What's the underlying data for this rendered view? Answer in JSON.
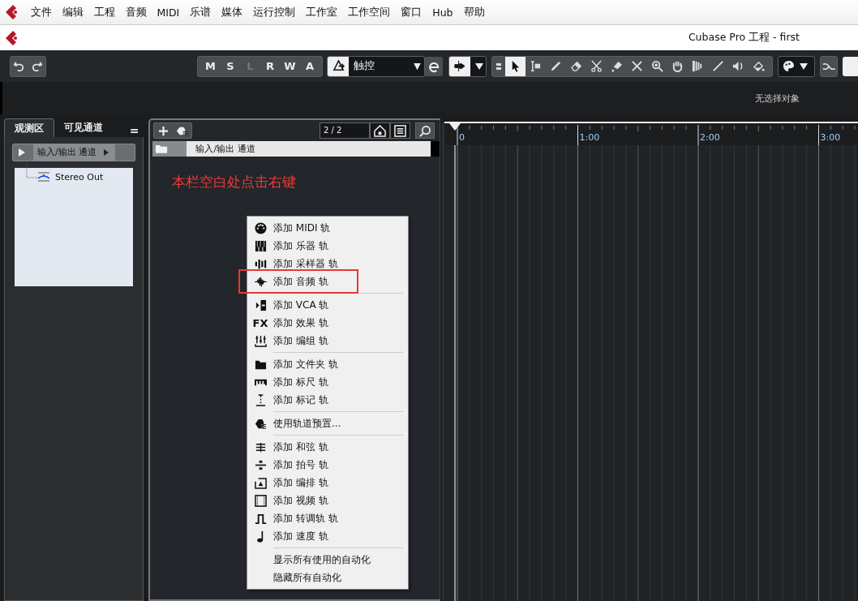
{
  "menu_bar": {
    "items": [
      "文件",
      "编辑",
      "工程",
      "音频",
      "MIDI",
      "乐谱",
      "媒体",
      "运行控制",
      "工作室",
      "工作空间",
      "窗口",
      "Hub",
      "帮助"
    ]
  },
  "window": {
    "title": "Cubase Pro 工程 - first"
  },
  "toolbar": {
    "mode_buttons": [
      {
        "label": "M",
        "disabled": false
      },
      {
        "label": "S",
        "disabled": false
      },
      {
        "label": "L",
        "disabled": true
      },
      {
        "label": "R",
        "disabled": false
      },
      {
        "label": "W",
        "disabled": false
      },
      {
        "label": "A",
        "disabled": false
      }
    ],
    "automation_mode": {
      "value": "触控",
      "arrow": "▼"
    },
    "tools": [
      {
        "kind": "pointer",
        "selected": true
      },
      {
        "kind": "range",
        "selected": false
      },
      {
        "kind": "pencil",
        "selected": false
      },
      {
        "kind": "eraser",
        "selected": false
      },
      {
        "kind": "scissors",
        "selected": false
      },
      {
        "kind": "glue",
        "selected": false
      },
      {
        "kind": "mute",
        "selected": false
      },
      {
        "kind": "zoom",
        "selected": false
      },
      {
        "kind": "hand",
        "selected": false
      },
      {
        "kind": "comp",
        "selected": false
      },
      {
        "kind": "line",
        "selected": false
      },
      {
        "kind": "speaker",
        "selected": false
      },
      {
        "kind": "fill",
        "selected": false
      }
    ]
  },
  "info_line": "无选择对象",
  "inspector": {
    "tabs": [
      {
        "label": "观测区",
        "selected": true
      },
      {
        "label": "可见通道",
        "selected": false
      }
    ],
    "menu_glyph": "=",
    "folder": "输入/输出 通道",
    "tree": [
      {
        "label": "Stereo Out"
      }
    ]
  },
  "track_list": {
    "counter": "2 / 2",
    "tracks": [
      {
        "name": "输入/输出 通道"
      }
    ],
    "annotation": "本栏空白处点击右键"
  },
  "ruler": {
    "labels": [
      "0",
      "1:00",
      "2:00",
      "3:00"
    ]
  },
  "context_menu": {
    "groups": [
      [
        {
          "label": "添加 MIDI 轨",
          "kind": "midi",
          "highlighted": false
        },
        {
          "label": "添加 乐器 轨",
          "kind": "instrument",
          "highlighted": false
        },
        {
          "label": "添加 采样器 轨",
          "kind": "sampler",
          "highlighted": false
        },
        {
          "label": "添加 音频 轨",
          "kind": "audio",
          "highlighted": true
        }
      ],
      [
        {
          "label": "添加 VCA 轨",
          "kind": "vca",
          "highlighted": false
        },
        {
          "label": "添加 效果 轨",
          "kind": "fx",
          "icon_text": "FX",
          "highlighted": false
        },
        {
          "label": "添加 编组 轨",
          "kind": "group",
          "highlighted": false
        }
      ],
      [
        {
          "label": "添加 文件夹 轨",
          "kind": "folder",
          "highlighted": false
        },
        {
          "label": "添加 标尺 轨",
          "kind": "ruler",
          "highlighted": false
        },
        {
          "label": "添加 标记 轨",
          "kind": "marker",
          "highlighted": false
        }
      ],
      [
        {
          "label": "使用轨道预置...",
          "kind": "preset",
          "highlighted": false
        }
      ],
      [
        {
          "label": "添加 和弦 轨",
          "kind": "chord",
          "highlighted": false
        },
        {
          "label": "添加 拍号 轨",
          "kind": "signature",
          "highlighted": false
        },
        {
          "label": "添加 编排 轨",
          "kind": "arranger",
          "highlighted": false
        },
        {
          "label": "添加 视频 轨",
          "kind": "video",
          "highlighted": false
        },
        {
          "label": "添加 转调轨 轨",
          "kind": "transpose",
          "highlighted": false
        },
        {
          "label": "添加 速度 轨",
          "kind": "tempo",
          "highlighted": false
        }
      ],
      [
        {
          "label": "显示所有使用的自动化",
          "kind": "none",
          "highlighted": false
        },
        {
          "label": "隐藏所有自动化",
          "kind": "none",
          "highlighted": false
        }
      ]
    ]
  }
}
